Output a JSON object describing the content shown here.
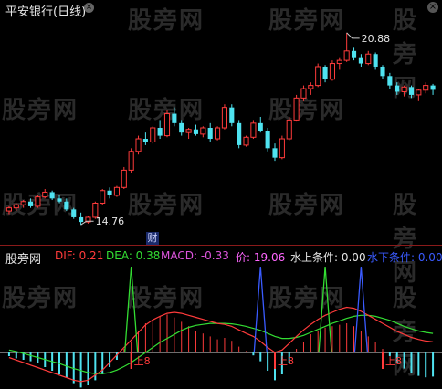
{
  "window": {
    "title": "平安银行(日线)",
    "watermark": "股旁网"
  },
  "price_panel": {
    "high_label": "20.88",
    "low_label": "14.76",
    "finance_badge": "财"
  },
  "indicator_panel": {
    "title": "股旁网",
    "dif": "DIF: 0.21",
    "dea": "DEA: 0.38",
    "macd": "MACD: -0.33",
    "price": "价: 19.06",
    "above": "水上条件: 0.00",
    "below": "水下条件: 0.00",
    "signals": [
      "上8",
      "上8",
      "上8"
    ]
  },
  "colors": {
    "background": "#000000",
    "up": "#ff3b3b",
    "down": "#4fe3f0",
    "dif": "#ff3b3b",
    "dea": "#33dd33",
    "macd": "#dd55dd",
    "price": "#ff66ff",
    "above": "#e6e6e6",
    "below": "#3a5bff"
  },
  "chart_data": {
    "type": "candlestick",
    "candles": [
      [
        15.2,
        15.35,
        15.1,
        15.3
      ],
      [
        15.3,
        15.45,
        15.2,
        15.4
      ],
      [
        15.4,
        15.55,
        15.3,
        15.5
      ],
      [
        15.5,
        15.6,
        15.3,
        15.35
      ],
      [
        15.35,
        15.7,
        15.3,
        15.65
      ],
      [
        15.65,
        15.9,
        15.6,
        15.8
      ],
      [
        15.8,
        15.85,
        15.55,
        15.6
      ],
      [
        15.6,
        15.7,
        15.45,
        15.5
      ],
      [
        15.5,
        15.6,
        15.2,
        15.25
      ],
      [
        15.25,
        15.3,
        14.95,
        15.0
      ],
      [
        15.0,
        15.15,
        14.76,
        14.85
      ],
      [
        14.85,
        15.05,
        14.8,
        15.0
      ],
      [
        15.0,
        15.5,
        14.95,
        15.45
      ],
      [
        15.45,
        15.9,
        15.4,
        15.85
      ],
      [
        15.85,
        15.95,
        15.6,
        15.7
      ],
      [
        15.7,
        16.0,
        15.65,
        15.95
      ],
      [
        15.95,
        16.6,
        15.9,
        16.5
      ],
      [
        16.5,
        17.2,
        16.4,
        17.1
      ],
      [
        17.1,
        17.6,
        17.0,
        17.5
      ],
      [
        17.5,
        17.7,
        17.3,
        17.4
      ],
      [
        17.4,
        17.9,
        17.35,
        17.85
      ],
      [
        17.85,
        18.1,
        17.5,
        17.6
      ],
      [
        17.6,
        18.4,
        17.55,
        18.3
      ],
      [
        18.3,
        18.5,
        17.9,
        18.0
      ],
      [
        18.0,
        18.1,
        17.6,
        17.7
      ],
      [
        17.7,
        17.85,
        17.5,
        17.8
      ],
      [
        17.8,
        17.95,
        17.6,
        17.65
      ],
      [
        17.65,
        17.9,
        17.55,
        17.85
      ],
      [
        17.85,
        18.0,
        17.4,
        17.5
      ],
      [
        17.5,
        17.9,
        17.45,
        17.85
      ],
      [
        17.85,
        18.6,
        17.8,
        18.5
      ],
      [
        18.5,
        18.6,
        17.9,
        18.0
      ],
      [
        18.0,
        18.1,
        17.2,
        17.3
      ],
      [
        17.3,
        17.6,
        17.25,
        17.55
      ],
      [
        17.55,
        18.1,
        17.5,
        18.0
      ],
      [
        18.0,
        18.2,
        17.7,
        17.75
      ],
      [
        17.75,
        17.85,
        17.1,
        17.2
      ],
      [
        17.2,
        17.35,
        16.8,
        16.9
      ],
      [
        16.9,
        17.6,
        16.85,
        17.5
      ],
      [
        17.5,
        18.2,
        17.45,
        18.1
      ],
      [
        18.1,
        18.9,
        18.05,
        18.8
      ],
      [
        18.8,
        19.2,
        18.7,
        19.1
      ],
      [
        19.1,
        19.3,
        18.9,
        19.2
      ],
      [
        19.2,
        19.9,
        19.15,
        19.8
      ],
      [
        19.8,
        19.85,
        19.3,
        19.4
      ],
      [
        19.4,
        20.0,
        19.35,
        19.9
      ],
      [
        19.9,
        20.1,
        19.7,
        20.0
      ],
      [
        20.0,
        20.88,
        19.95,
        20.3
      ],
      [
        20.3,
        20.4,
        20.0,
        20.1
      ],
      [
        20.1,
        20.2,
        19.8,
        19.9
      ],
      [
        19.9,
        20.3,
        19.85,
        20.2
      ],
      [
        20.2,
        20.25,
        19.7,
        19.8
      ],
      [
        19.8,
        19.85,
        19.4,
        19.5
      ],
      [
        19.5,
        19.6,
        19.1,
        19.2
      ],
      [
        19.2,
        19.3,
        18.9,
        19.0
      ],
      [
        19.0,
        19.2,
        18.85,
        19.15
      ],
      [
        19.15,
        19.2,
        18.8,
        18.9
      ],
      [
        18.9,
        19.1,
        18.7,
        19.05
      ],
      [
        19.05,
        19.3,
        18.95,
        19.2
      ],
      [
        19.2,
        19.25,
        18.9,
        19.06
      ]
    ],
    "price_range": [
      14.3,
      21.4
    ],
    "macd_hist": [
      -0.05,
      -0.08,
      -0.1,
      -0.12,
      -0.15,
      -0.2,
      -0.25,
      -0.3,
      -0.35,
      -0.42,
      -0.48,
      -0.45,
      -0.38,
      -0.3,
      -0.2,
      -0.1,
      0.05,
      0.15,
      0.3,
      0.4,
      0.45,
      0.5,
      0.52,
      0.48,
      0.42,
      0.36,
      0.3,
      0.26,
      0.22,
      0.18,
      0.2,
      0.16,
      0.08,
      0.02,
      -0.04,
      -0.12,
      -0.25,
      -0.38,
      -0.3,
      -0.15,
      0.05,
      0.15,
      0.25,
      0.3,
      0.34,
      0.36,
      0.38,
      0.4,
      0.36,
      0.3,
      0.22,
      0.14,
      0.05,
      -0.05,
      -0.15,
      -0.22,
      -0.28,
      -0.32,
      -0.34,
      -0.33
    ],
    "dif": [
      -0.1,
      -0.15,
      -0.2,
      -0.25,
      -0.3,
      -0.35,
      -0.4,
      -0.45,
      -0.5,
      -0.55,
      -0.58,
      -0.55,
      -0.45,
      -0.35,
      -0.2,
      -0.05,
      0.1,
      0.25,
      0.4,
      0.55,
      0.65,
      0.72,
      0.78,
      0.8,
      0.78,
      0.74,
      0.7,
      0.66,
      0.62,
      0.58,
      0.56,
      0.52,
      0.45,
      0.38,
      0.32,
      0.22,
      0.1,
      0.0,
      0.05,
      0.18,
      0.32,
      0.45,
      0.56,
      0.66,
      0.74,
      0.8,
      0.86,
      0.9,
      0.88,
      0.82,
      0.74,
      0.66,
      0.58,
      0.5,
      0.42,
      0.36,
      0.3,
      0.26,
      0.23,
      0.21
    ],
    "dea": [
      0.05,
      0.02,
      -0.02,
      -0.06,
      -0.1,
      -0.14,
      -0.18,
      -0.22,
      -0.27,
      -0.32,
      -0.36,
      -0.4,
      -0.42,
      -0.42,
      -0.4,
      -0.35,
      -0.28,
      -0.2,
      -0.1,
      0.0,
      0.1,
      0.2,
      0.28,
      0.36,
      0.44,
      0.5,
      0.54,
      0.56,
      0.58,
      0.58,
      0.58,
      0.57,
      0.55,
      0.52,
      0.48,
      0.44,
      0.38,
      0.32,
      0.28,
      0.28,
      0.3,
      0.34,
      0.4,
      0.46,
      0.52,
      0.58,
      0.63,
      0.68,
      0.72,
      0.74,
      0.74,
      0.72,
      0.68,
      0.64,
      0.58,
      0.52,
      0.47,
      0.43,
      0.4,
      0.38
    ],
    "above_spikes": [
      17,
      44
    ],
    "below_spikes": [
      35,
      49
    ],
    "signal_points": [
      17,
      37,
      52
    ]
  }
}
